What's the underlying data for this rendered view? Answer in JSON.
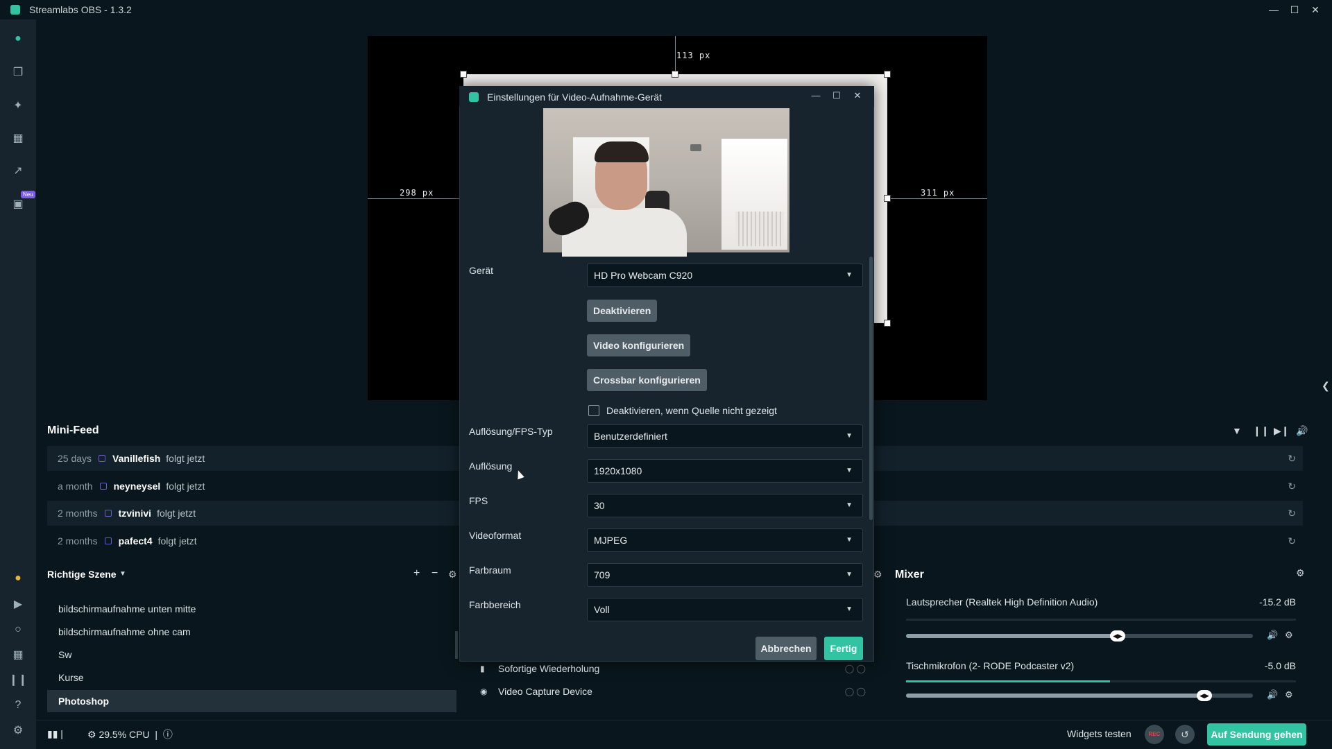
{
  "app": {
    "title": "Streamlabs OBS - 1.3.2",
    "accent_color": "#31c3a2",
    "window_controls": [
      "minimize-icon",
      "maximize-icon",
      "close-icon"
    ]
  },
  "left_nav": {
    "items": [
      {
        "name": "editor",
        "icon": "camera-icon",
        "active": true
      },
      {
        "name": "themes",
        "icon": "copy-icon"
      },
      {
        "name": "app-store",
        "icon": "tools-icon"
      },
      {
        "name": "store",
        "icon": "store-icon"
      },
      {
        "name": "dashboard",
        "icon": "chart-icon"
      },
      {
        "name": "highlighter",
        "icon": "film-icon",
        "badge": "Neu"
      }
    ],
    "bottom_items": [
      "prime-icon",
      "play-icon",
      "chat-icon",
      "grid-icon",
      "studio-icon",
      "help-icon",
      "settings-icon"
    ]
  },
  "editor": {
    "guide_top": "113 px",
    "guide_left": "298 px",
    "guide_right": "311 px"
  },
  "mini_feed": {
    "title": "Mini-Feed",
    "rows": [
      {
        "time": "25 days",
        "user": "Vanillefish",
        "action": "folgt jetzt"
      },
      {
        "time": "a month",
        "user": "neyneysel",
        "action": "folgt jetzt"
      },
      {
        "time": "2 months",
        "user": "tzvinivi",
        "action": "folgt jetzt"
      },
      {
        "time": "2 months",
        "user": "pafect4",
        "action": "folgt jetzt"
      }
    ]
  },
  "scenes": {
    "title": "Richtige Szene",
    "items": [
      {
        "label": "bildschirmaufnahme unten mitte"
      },
      {
        "label": "bildschirmaufnahme ohne cam"
      },
      {
        "label": "Sw"
      },
      {
        "label": "Kurse"
      },
      {
        "label": "Photoshop",
        "selected": true
      }
    ]
  },
  "sources": {
    "items": [
      {
        "label": "Sofortige Wiederholung",
        "icon": "replay-icon"
      },
      {
        "label": "Video Capture Device",
        "icon": "webcam-icon"
      }
    ]
  },
  "mixer": {
    "title": "Mixer",
    "channels": [
      {
        "name": "Lautsprecher (Realtek High Definition Audio)",
        "db": "-15.2 dB",
        "volume_fraction": 0.61
      },
      {
        "name": "Tischmikrofon (2- RODE Podcaster v2)",
        "db": "-5.0 dB",
        "volume_fraction": 0.86
      }
    ]
  },
  "footer": {
    "cpu": "29.5% CPU",
    "widgets_test": "Widgets testen",
    "rec": "REC",
    "go_live": "Auf Sendung gehen"
  },
  "dialog": {
    "title": "Einstellungen für Video-Aufnahme-Gerät",
    "device_label": "Gerät",
    "device_value": "HD Pro Webcam C920",
    "btn_deactivate": "Deaktivieren",
    "btn_configure_video": "Video konfigurieren",
    "btn_configure_crossbar": "Crossbar konfigurieren",
    "checkbox_label": "Deaktivieren, wenn Quelle nicht gezeigt",
    "checkbox_checked": false,
    "res_fps_type_label": "Auflösung/FPS-Typ",
    "res_fps_type_value": "Benutzerdefiniert",
    "resolution_label": "Auflösung",
    "resolution_value": "1920x1080",
    "fps_label": "FPS",
    "fps_value": "30",
    "video_format_label": "Videoformat",
    "video_format_value": "MJPEG",
    "color_space_label": "Farbraum",
    "color_space_value": "709",
    "color_range_label": "Farbbereich",
    "color_range_value": "Voll",
    "cancel": "Abbrechen",
    "done": "Fertig"
  }
}
